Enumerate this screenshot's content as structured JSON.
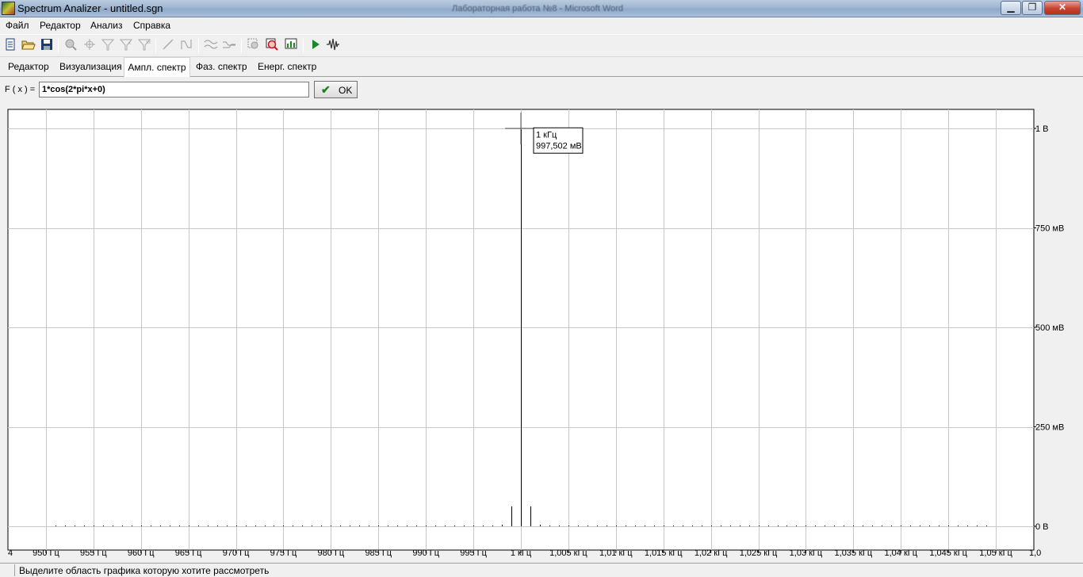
{
  "window": {
    "title": "Spectrum Analizer - untitled.sgn",
    "background_title": "Лабораторная работа №8 - Microsoft Word"
  },
  "menu": [
    {
      "label": "Файл"
    },
    {
      "label": "Редактор"
    },
    {
      "label": "Анализ"
    },
    {
      "label": "Справка"
    }
  ],
  "toolbar": {
    "icons": [
      "new-icon",
      "open-icon",
      "save-icon",
      "zoom-icon",
      "crosshair-icon",
      "filter-icon",
      "filter2-icon",
      "filter3-icon",
      "line-icon",
      "curve-icon",
      "smooth-icon",
      "smooth2-icon",
      "zoom-rect-icon",
      "zoom-reset-icon",
      "chart-settings-icon",
      "play-icon",
      "waveform-icon"
    ]
  },
  "tabs": [
    {
      "label": "Редактор",
      "active": false
    },
    {
      "label": "Визуализация",
      "active": false
    },
    {
      "label": "Ампл. спектр",
      "active": true
    },
    {
      "label": "Фаз. спектр",
      "active": false
    },
    {
      "label": "Енерг. спектр",
      "active": false
    }
  ],
  "formula": {
    "label": "F ( x ) =",
    "value": "1*cos(2*pi*x+0)",
    "ok_label": "OK"
  },
  "chart_data": {
    "type": "bar",
    "x_unit": "Hz",
    "y_unit": "V",
    "xlim": [
      946,
      1054
    ],
    "ylim": [
      0,
      1.05
    ],
    "grid": true,
    "x_tick_values": [
      950,
      955,
      960,
      965,
      970,
      975,
      980,
      985,
      990,
      995,
      1000,
      1005,
      1010,
      1015,
      1020,
      1025,
      1030,
      1035,
      1040,
      1045,
      1050
    ],
    "x_tick_labels": [
      "950 Гц",
      "955 Гц",
      "960 Гц",
      "965 Гц",
      "970 Гц",
      "975 Гц",
      "980 Гц",
      "985 Гц",
      "990 Гц",
      "995 Гц",
      "1 кГц",
      "1,005 кГц",
      "1,01 кГц",
      "1,015 кГц",
      "1,02 кГц",
      "1,025 кГц",
      "1,03 кГц",
      "1,035 кГц",
      "1,04 кГц",
      "1,045 кГц",
      "1,05 кГц"
    ],
    "x_edge_labels": [
      "4",
      "1,0"
    ],
    "y_tick_values": [
      0,
      0.25,
      0.5,
      0.75,
      1
    ],
    "y_tick_labels": [
      "0 В",
      "250 мВ",
      "500 мВ",
      "750 мВ",
      "1 В"
    ],
    "series": [
      {
        "x": [
          951,
          952,
          953,
          954,
          955,
          956,
          957,
          958,
          959,
          960,
          961,
          962,
          963,
          964,
          965,
          966,
          967,
          968,
          969,
          970,
          971,
          972,
          973,
          974,
          975,
          976,
          977,
          978,
          979,
          980,
          981,
          982,
          983,
          984,
          985,
          986,
          987,
          988,
          989,
          990,
          991,
          992,
          993,
          994,
          995,
          996,
          997,
          998,
          999,
          1000,
          1001,
          1002,
          1003,
          1004,
          1005,
          1006,
          1007,
          1008,
          1009,
          1010,
          1011,
          1012,
          1013,
          1014,
          1015,
          1016,
          1017,
          1018,
          1019,
          1020,
          1021,
          1022,
          1023,
          1024,
          1025,
          1026,
          1027,
          1028,
          1029,
          1030,
          1031,
          1032,
          1033,
          1034,
          1035,
          1036,
          1037,
          1038,
          1039,
          1040,
          1041,
          1042,
          1043,
          1044,
          1045,
          1046,
          1047,
          1048,
          1049
        ],
        "values": [
          0.002,
          0.002,
          0.002,
          0.002,
          0.002,
          0.002,
          0.002,
          0.002,
          0.002,
          0.002,
          0.002,
          0.002,
          0.002,
          0.002,
          0.002,
          0.002,
          0.002,
          0.002,
          0.002,
          0.002,
          0.002,
          0.002,
          0.002,
          0.002,
          0.002,
          0.002,
          0.002,
          0.002,
          0.002,
          0.002,
          0.002,
          0.002,
          0.002,
          0.002,
          0.002,
          0.002,
          0.002,
          0.002,
          0.002,
          0.002,
          0.002,
          0.002,
          0.002,
          0.002,
          0.002,
          0.002,
          0.002,
          0.004,
          0.05,
          0.9975,
          0.05,
          0.004,
          0.002,
          0.002,
          0.002,
          0.002,
          0.002,
          0.002,
          0.002,
          0.002,
          0.002,
          0.002,
          0.002,
          0.002,
          0.002,
          0.002,
          0.002,
          0.002,
          0.002,
          0.002,
          0.002,
          0.002,
          0.002,
          0.002,
          0.002,
          0.002,
          0.002,
          0.002,
          0.002,
          0.002,
          0.002,
          0.002,
          0.002,
          0.002,
          0.002,
          0.002,
          0.002,
          0.002,
          0.002,
          0.002,
          0.002,
          0.002,
          0.002,
          0.002,
          0.002,
          0.002,
          0.002,
          0.002,
          0.002
        ]
      }
    ],
    "annotation": {
      "x": 1000,
      "y": 0.9975,
      "lines": [
        "1 кГц",
        "997,502 мВ"
      ]
    },
    "cursor": {
      "x": 1000,
      "y": 1.0
    }
  },
  "status": {
    "text": "Выделите область графика которую хотите рассмотреть"
  }
}
